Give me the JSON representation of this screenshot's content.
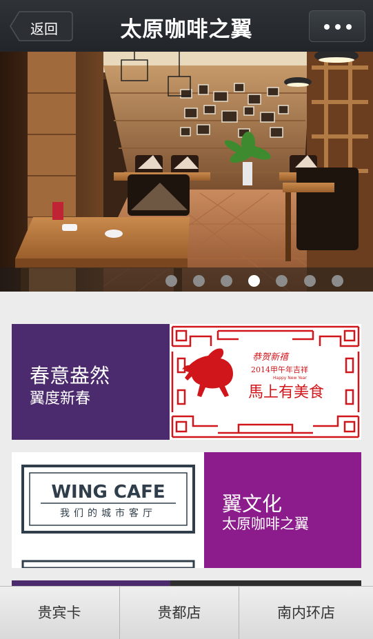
{
  "navbar": {
    "back_label": "返回",
    "title": "太原咖啡之翼",
    "more_icon": "more-dots-icon"
  },
  "carousel": {
    "slide_count": 7,
    "active_index": 3
  },
  "cards": [
    {
      "title": "春意盎然",
      "subtitle": "翼度新春",
      "color": "#4c2a6e",
      "art": {
        "greeting": "恭贺新禧",
        "year_line": "2014甲午年吉祥",
        "english": "Happy New Year",
        "headline": "馬上有美食"
      }
    },
    {
      "title": "翼文化",
      "subtitle": "太原咖啡之翼",
      "color": "#8c1b8c",
      "art": {
        "logo_text": "WING CAFE",
        "tagline": "我们的城市客厅"
      }
    }
  ],
  "tabbar": {
    "items": [
      "贵宾卡",
      "贵都店",
      "南内环店"
    ]
  },
  "colors": {
    "navbar": "#2a2e32",
    "card_purple": "#4c2a6e",
    "card_magenta": "#8c1b8c",
    "festive_red": "#d0161b"
  }
}
